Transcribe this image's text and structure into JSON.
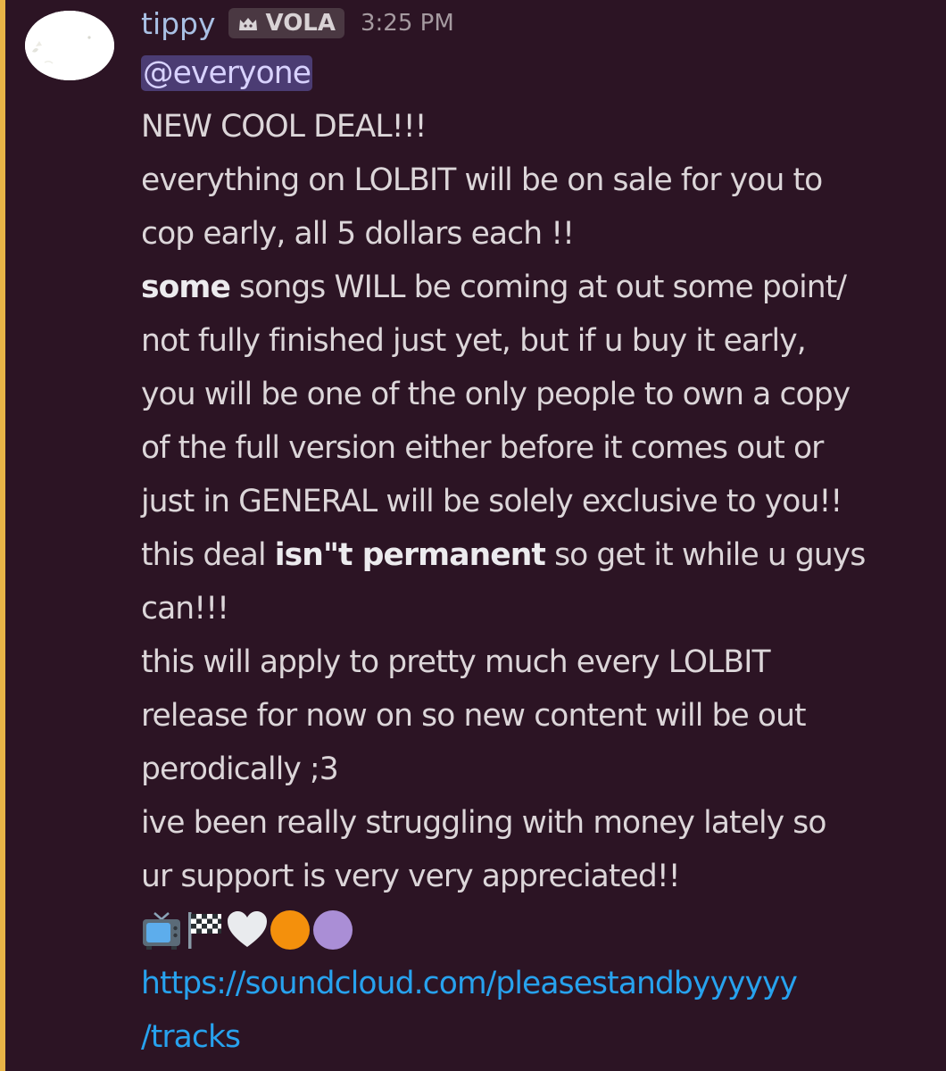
{
  "message": {
    "author": "tippy",
    "role_tag": {
      "icon": "cat-icon",
      "label": "VOLA"
    },
    "timestamp": "3:25 PM",
    "mention": "@everyone",
    "lines": {
      "l1": "NEW COOL DEAL!!!",
      "l2": "everything on LOLBIT will be on sale for you to",
      "l3": "cop early, all 5 dollars each !!",
      "l4_bold": "some",
      "l4_rest": " songs WILL be coming at out some point/",
      "l5": "not fully finished just yet, but if u buy it early,",
      "l6": "you will be one of the only people to own a copy",
      "l7": "of the full version either before it comes out or",
      "l8": "just in GENERAL will be solely exclusive to you!!",
      "l9_pre": "this deal ",
      "l9_bold": "isn\"t permanent",
      "l9_post": " so get it while u guys",
      "l10": "can!!!",
      "l11": "this will apply to pretty much every LOLBIT",
      "l12": "release for now on so new content will be out",
      "l13": "perodically ;3",
      "l14": "ive been really struggling with money lately so",
      "l15": "ur support is very very appreciated!!"
    },
    "emojis": [
      "television-icon",
      "checkered-flag-icon",
      "white-heart-icon",
      "orange-circle-icon",
      "purple-circle-icon"
    ],
    "link_line1": "https://soundcloud.com/pleasestandbyyyyyy",
    "link_line2": "/tracks"
  },
  "colors": {
    "background": "#2c1424",
    "mention_bar": "#e8b447",
    "username": "#a9c0e4",
    "link": "#27a2ee",
    "mention_bg": "#4b3c73"
  }
}
